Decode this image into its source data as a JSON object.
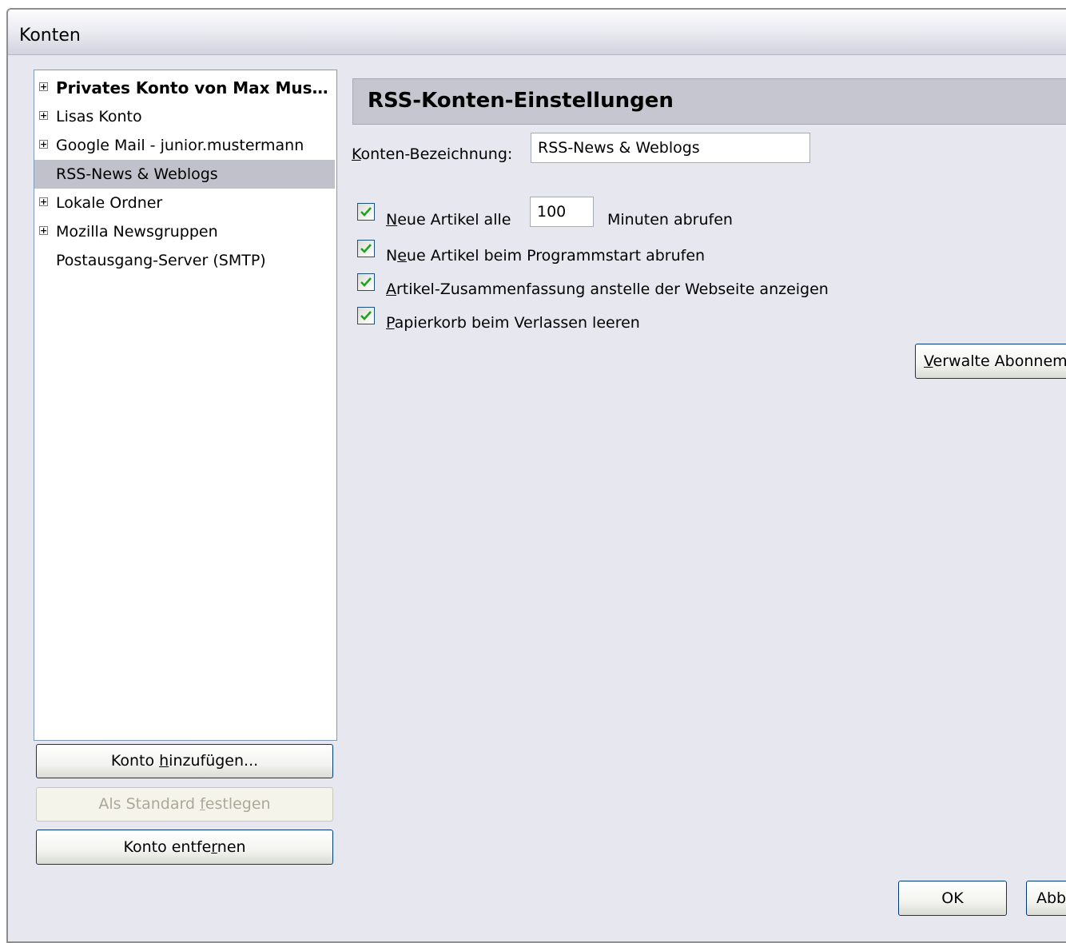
{
  "window": {
    "title": "Konten"
  },
  "tree": {
    "items": [
      {
        "label": "Privates Konto von Max Mus…",
        "expandable": true,
        "bold": true,
        "selected": false
      },
      {
        "label": "Lisas Konto",
        "expandable": true,
        "bold": false,
        "selected": false
      },
      {
        "label": "Google Mail - junior.mustermann",
        "expandable": true,
        "bold": false,
        "selected": false
      },
      {
        "label": "RSS-News & Weblogs",
        "expandable": false,
        "bold": false,
        "selected": true
      },
      {
        "label": "Lokale Ordner",
        "expandable": true,
        "bold": false,
        "selected": false
      },
      {
        "label": "Mozilla Newsgruppen",
        "expandable": true,
        "bold": false,
        "selected": false
      },
      {
        "label": "Postausgang-Server (SMTP)",
        "expandable": false,
        "bold": false,
        "selected": false
      }
    ]
  },
  "buttons": {
    "add_account": {
      "pre": "Konto ",
      "accel": "h",
      "post": "inzufügen..."
    },
    "set_default": {
      "pre": "Als Standard ",
      "accel": "f",
      "post": "estlegen"
    },
    "remove_account": {
      "pre": "Konto entfe",
      "accel": "r",
      "post": "nen"
    },
    "manage_subscriptions": {
      "pre": "",
      "accel": "V",
      "post": "erwalte Abonnem"
    },
    "ok": "OK",
    "cancel": "Abb"
  },
  "settings": {
    "header": "RSS-Konten-Einstellungen",
    "name_label": {
      "pre": "",
      "accel": "K",
      "post": "onten-Bezeichnung:"
    },
    "name_value": "RSS-News & Weblogs",
    "check_interval": {
      "pre": "",
      "accel": "N",
      "post": "eue Artikel alle",
      "checked": true
    },
    "interval_value": "100",
    "interval_unit": "Minuten abrufen",
    "check_startup": {
      "pre": "N",
      "accel": "e",
      "post": "ue Artikel beim Programmstart abrufen",
      "checked": true
    },
    "summary": {
      "pre": "",
      "accel": "A",
      "post": "rtikel-Zusammenfassung anstelle der Webseite anzeigen",
      "checked": true
    },
    "empty_trash": {
      "pre": "",
      "accel": "P",
      "post": "apierkorb beim Verlassen leeren",
      "checked": true
    }
  },
  "icons": {
    "expander": "plus-box-icon",
    "check": "checkmark-icon"
  },
  "colors": {
    "selection": "#c1c1cb",
    "check": "#21a121",
    "header_bg": "#c6c6d0"
  }
}
